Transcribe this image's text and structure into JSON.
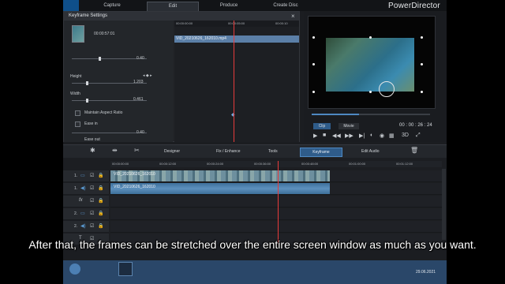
{
  "app": {
    "title": "PowerDirector",
    "nav_tabs": [
      {
        "label": "Capture"
      },
      {
        "label": "Edit"
      },
      {
        "label": "Produce"
      },
      {
        "label": "Create Disc"
      }
    ]
  },
  "keyframe_panel": {
    "title": "Keyframe Settings",
    "close": "×",
    "clip_time": "00:00:57:01",
    "value_top": "0.40",
    "height_label": "Height",
    "height_value": "1.203",
    "width_label": "Width",
    "width_value": "0.461",
    "maintain_aspect": "Maintain Aspect Ratio",
    "ease_in": "Ease in",
    "ease_in_value": "0.40",
    "ease_out": "Ease out",
    "ruler_start": "00:00:00:00",
    "ruler_mid": "00:00:05:00",
    "ruler_end": "00:00:10",
    "clip_name": "VID_20210626_162010.mp4"
  },
  "preview": {
    "clip_tab": "Clip",
    "movie_tab": "Movie",
    "timecode": "00 : 00 : 26 : 24",
    "mode": "3D"
  },
  "toolbar": {
    "designer": "Designer",
    "fix_enhance": "Fix / Enhance",
    "tools": "Tools",
    "keyframe": "Keyframe",
    "edit_audio": "Edit Audio"
  },
  "timeline": {
    "ruler": [
      "00:00:00:00",
      "00:00:12:00",
      "00:00:24:00",
      "00:00:36:00",
      "00:00:48:00",
      "00:01:00:00",
      "00:01:12:00"
    ],
    "tracks": [
      {
        "label": "1."
      },
      {
        "label": "1."
      },
      {
        "label": "fx"
      },
      {
        "label": "2."
      },
      {
        "label": "2."
      },
      {
        "label": "T"
      }
    ],
    "video_clip": "VID_20210626_162010",
    "audio_clip": "VID_20210626_162010"
  },
  "taskbar": {
    "date": "29.06.2021"
  },
  "subtitle": "After that, the frames can be stretched over the entire screen window as much as you want."
}
